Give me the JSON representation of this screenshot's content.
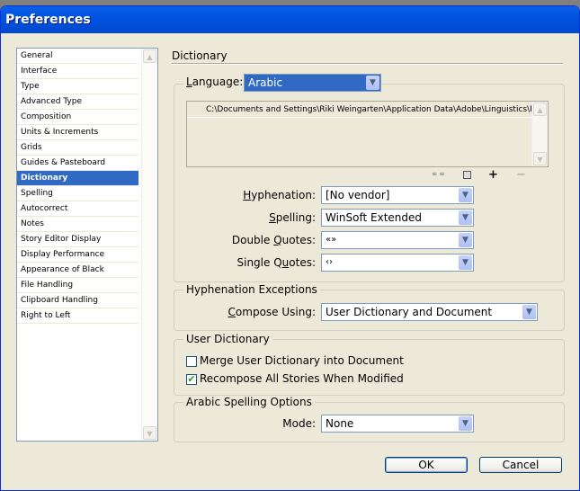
{
  "window": {
    "title": "Preferences"
  },
  "sidebar": {
    "items": [
      "General",
      "Interface",
      "Type",
      "Advanced Type",
      "Composition",
      "Units & Increments",
      "Grids",
      "Guides & Pasteboard",
      "Dictionary",
      "Spelling",
      "Autocorrect",
      "Notes",
      "Story Editor Display",
      "Display Performance",
      "Appearance of Black",
      "File Handling",
      "Clipboard Handling",
      "Right to Left"
    ],
    "selected": "Dictionary"
  },
  "panel": {
    "title": "Dictionary",
    "language": {
      "label": "Language:",
      "value": "Arabic"
    },
    "dictionary_path": "C:\\Documents and Settings\\Riki Weingarten\\Application Data\\Adobe\\Linguistics\\Dictionari",
    "icons": [
      "relink-icon",
      "new-dictionary-icon",
      "add-icon",
      "remove-icon"
    ],
    "hyphenation": {
      "label": "Hyphenation:",
      "value": "[No vendor]"
    },
    "spelling": {
      "label": "Spelling:",
      "value": "WinSoft Extended"
    },
    "double_quotes": {
      "label": "Double Quotes:",
      "value": "«»"
    },
    "single_quotes": {
      "label": "Single Quotes:",
      "value": "‹›"
    },
    "hyph_exceptions": {
      "title": "Hyphenation Exceptions",
      "compose_label": "Compose Using:",
      "compose_value": "User Dictionary and Document"
    },
    "user_dictionary": {
      "title": "User Dictionary",
      "merge": {
        "label": "Merge User Dictionary into Document",
        "checked": false
      },
      "recompose": {
        "label": "Recompose All Stories When Modified",
        "checked": true
      }
    },
    "arabic": {
      "title": "Arabic Spelling Options",
      "mode_label": "Mode:",
      "mode_value": "None"
    }
  },
  "buttons": {
    "ok": "OK",
    "cancel": "Cancel"
  }
}
